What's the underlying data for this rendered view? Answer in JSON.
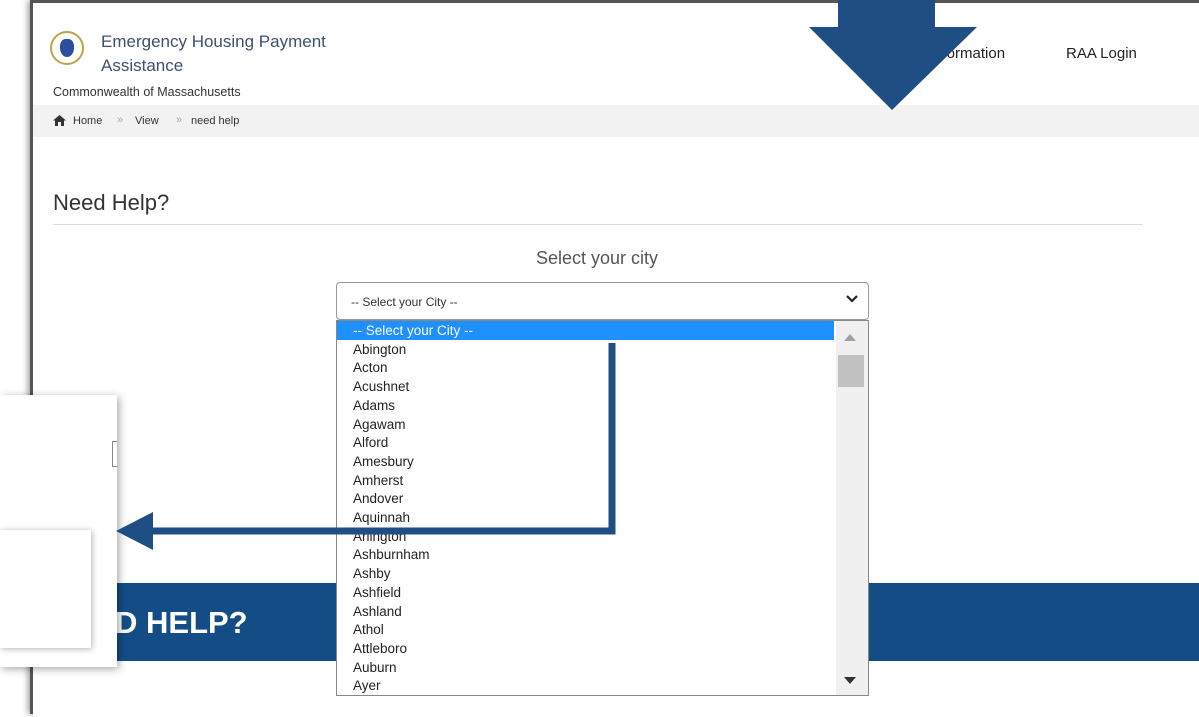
{
  "header": {
    "title": "Emergency Housing Payment Assistance",
    "subtitle": "Commonwealth of Massachusetts",
    "nav": [
      "Information",
      "RAA Login"
    ]
  },
  "breadcrumb": [
    "Home",
    "View",
    "need help"
  ],
  "page": {
    "heading": "Need Help?",
    "select_label": "Select your city",
    "select_value": "-- Select your City --"
  },
  "dropdown": {
    "options": [
      "-- Select your City --",
      "Abington",
      "Acton",
      "Acushnet",
      "Adams",
      "Agawam",
      "Alford",
      "Amesbury",
      "Amherst",
      "Andover",
      "Aquinnah",
      "Arlington",
      "Ashburnham",
      "Ashby",
      "Ashfield",
      "Ashland",
      "Athol",
      "Attleboro",
      "Auburn",
      "Ayer"
    ],
    "selected_index": 0
  },
  "banner": {
    "text": "D HELP?"
  },
  "colors": {
    "banner": "#144d86",
    "selected": "#1e90ff",
    "annotation": "#1f4e85"
  }
}
